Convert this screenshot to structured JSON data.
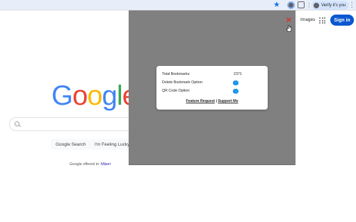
{
  "browser": {
    "profile_label": "Verify it's you"
  },
  "google": {
    "images_link": "Images",
    "signin_label": "Sign in",
    "logo_letters": [
      "G",
      "o",
      "o",
      "g",
      "l",
      "e"
    ],
    "search_button": "Google Search",
    "lucky_button": "I'm Feeling Lucky",
    "offered_text": "Google offered in:",
    "offered_language": "Māori"
  },
  "extension_popup": {
    "close_symbol": "✕",
    "total_bookmarks_label": "Total Bookmarks:",
    "total_bookmarks_value": "2371",
    "delete_option_label": "Delete Bookmark Option:",
    "delete_option_on": true,
    "qr_option_label": "QR Code Option:",
    "qr_option_on": true,
    "feature_request_link": "Feature Request",
    "link_separator": "|",
    "support_link": "Support Me"
  },
  "colors": {
    "accent": "#1a73e8",
    "signin_bg": "#0b57d0",
    "overlay_bg": "#808080",
    "close_red": "#d93025"
  },
  "icons": [
    "star-icon",
    "extension-icon",
    "puzzle-icon",
    "profile-icon",
    "kebab-menu-icon",
    "apps-grid-icon",
    "search-icon",
    "close-icon",
    "cursor-icon"
  ]
}
